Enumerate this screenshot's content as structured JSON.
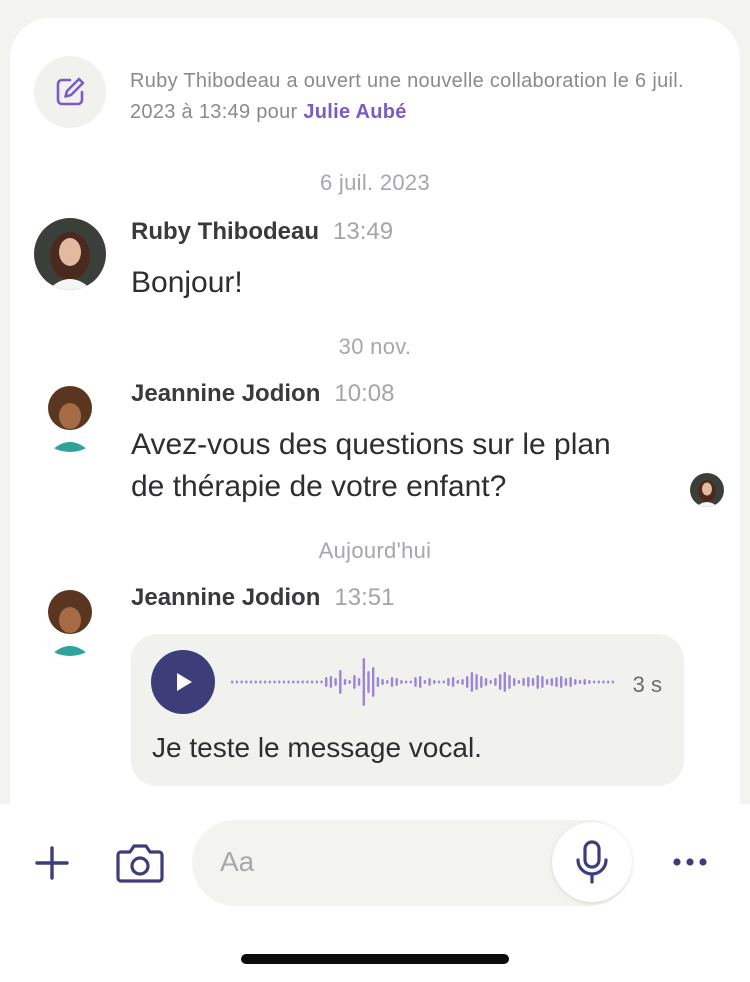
{
  "event": {
    "text": "Ruby Thibodeau a ouvert une nouvelle collaboration le 6 juil. 2023 à 13:49 pour",
    "link": "Julie Aubé",
    "icon": "edit-note-icon"
  },
  "messages": [
    {
      "date_separator": "6 juil. 2023",
      "author": "Ruby Thibodeau",
      "time": "13:49",
      "text": "Bonjour!"
    },
    {
      "date_separator": "30 nov.",
      "author": "Jeannine Jodion",
      "time": "10:08",
      "text_line1": "Avez-vous des questions sur le plan",
      "text_line2": "de thérapie de votre enfant?"
    },
    {
      "date_separator": "Aujourd'hui",
      "author": "Jeannine Jodion",
      "time": "13:51",
      "voice_duration": "3 s",
      "transcript": "Je teste le message vocal."
    }
  ],
  "composer": {
    "placeholder": "Aa",
    "icons": [
      "plus-icon",
      "camera-icon",
      "microphone-icon",
      "more-icon"
    ]
  },
  "colors": {
    "accent_purple": "#7b5cc4",
    "play_button": "#3d3d7a",
    "waveform": "#9b86d3",
    "icon_navy": "#3d3d7a"
  }
}
